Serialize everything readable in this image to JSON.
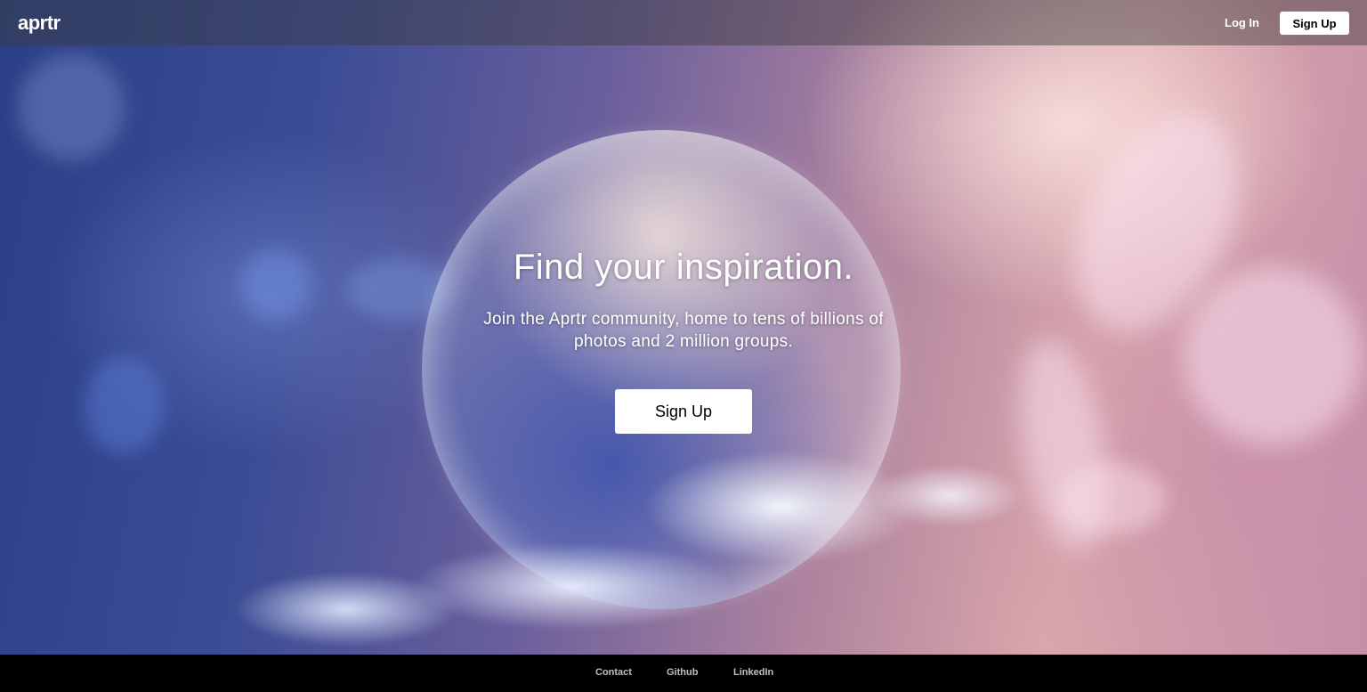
{
  "navbar": {
    "logo": "aprtr",
    "login_label": "Log In",
    "signup_label": "Sign Up"
  },
  "hero": {
    "headline": "Find your inspiration.",
    "subheadline": "Join the Aprtr community, home to tens of billions of photos and 2 million groups.",
    "cta_label": "Sign Up"
  },
  "footer": {
    "links": [
      "Contact",
      "Github",
      "LinkedIn"
    ]
  }
}
